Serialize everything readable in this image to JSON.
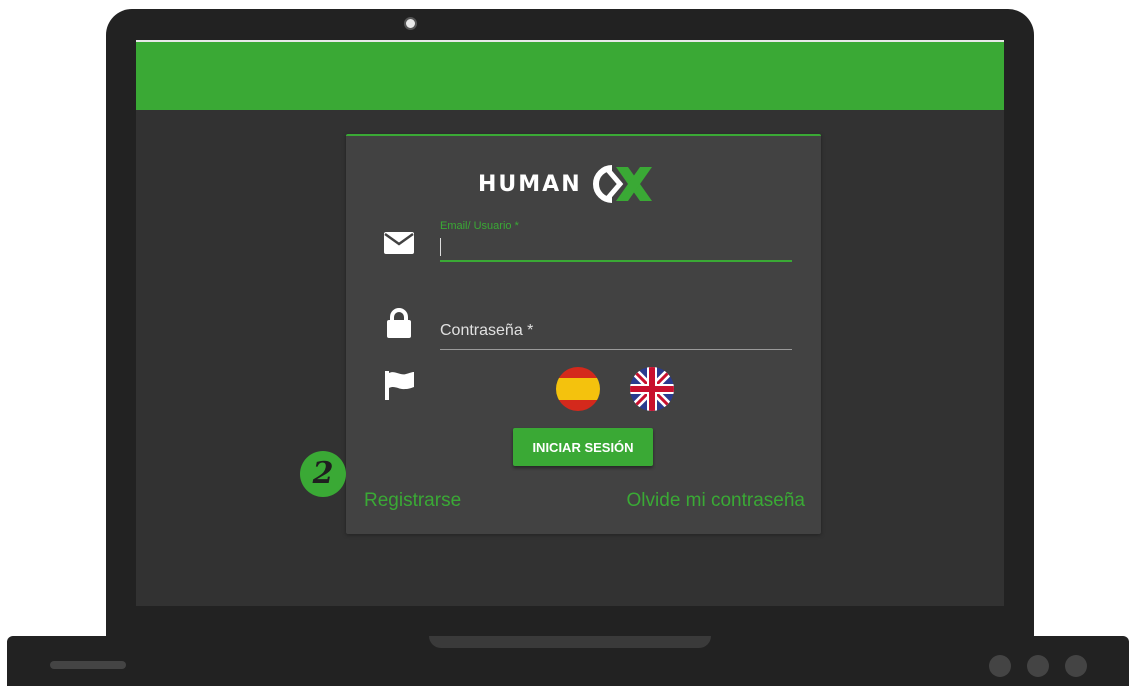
{
  "brand": {
    "name": "HUMAN",
    "accent_color": "#3aa935",
    "logo_icon": "humanox-x-mark-icon"
  },
  "login_form": {
    "email_label": "Email/ Usuario *",
    "email_value": "",
    "password_label": "Contraseña *",
    "submit_label": "INICIAR SESIÓN"
  },
  "languages": [
    {
      "code": "es",
      "icon": "spain-flag-icon"
    },
    {
      "code": "en",
      "icon": "uk-flag-icon"
    }
  ],
  "links": {
    "register": "Registrarse",
    "forgot_password": "Olvide mi contraseña"
  },
  "step_badge": "2",
  "icons": {
    "email": "envelope-icon",
    "password": "lock-icon",
    "language": "flag-icon"
  }
}
